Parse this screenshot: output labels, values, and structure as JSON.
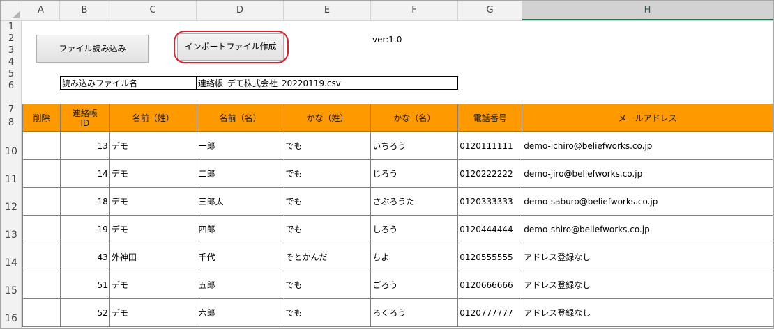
{
  "columns": [
    "A",
    "B",
    "C",
    "D",
    "E",
    "F",
    "G",
    "H"
  ],
  "active_column": "H",
  "rows": [
    "1",
    "2",
    "3",
    "4",
    "5",
    "6",
    "7",
    "8",
    "10",
    "11",
    "12",
    "13",
    "14",
    "15",
    "16"
  ],
  "buttons": {
    "load_file": "ファイル読み込み",
    "create_import": "インポートファイル作成"
  },
  "version": "ver:1.0",
  "file": {
    "label": "読み込みファイル名",
    "value": "連絡帳_デモ株式会社_20220119.csv"
  },
  "table": {
    "headers": [
      "削除",
      "連絡帳ID",
      "名前（姓）",
      "名前（名）",
      "かな（姓）",
      "かな（名）",
      "電話番号",
      "メールアドレス"
    ],
    "header_id_line1": "連絡帳",
    "header_id_line2": "ID",
    "rows": [
      {
        "delete": "",
        "id": "13",
        "last": "デモ",
        "first": "一郎",
        "kana_last": "でも",
        "kana_first": "いちろう",
        "phone": "0120111111",
        "email": "demo-ichiro@beliefworks.co.jp"
      },
      {
        "delete": "",
        "id": "14",
        "last": "デモ",
        "first": "二郎",
        "kana_last": "でも",
        "kana_first": "じろう",
        "phone": "0120222222",
        "email": "demo-jiro@beliefworks.co.jp"
      },
      {
        "delete": "",
        "id": "18",
        "last": "デモ",
        "first": "三郎太",
        "kana_last": "でも",
        "kana_first": "さぶろうた",
        "phone": "0120333333",
        "email": "demo-saburo@beliefworks.co.jp"
      },
      {
        "delete": "",
        "id": "19",
        "last": "デモ",
        "first": "四郎",
        "kana_last": "でも",
        "kana_first": "しろう",
        "phone": "0120444444",
        "email": "demo-shiro@beliefworks.co.jp"
      },
      {
        "delete": "",
        "id": "43",
        "last": "外神田",
        "first": "千代",
        "kana_last": "そとかんだ",
        "kana_first": "ちよ",
        "phone": "0120555555",
        "email": "アドレス登録なし"
      },
      {
        "delete": "",
        "id": "51",
        "last": "デモ",
        "first": "五郎",
        "kana_last": "でも",
        "kana_first": "ごろう",
        "phone": "0120666666",
        "email": "アドレス登録なし"
      },
      {
        "delete": "",
        "id": "52",
        "last": "デモ",
        "first": "六郎",
        "kana_last": "でも",
        "kana_first": "ろくろう",
        "phone": "0120777777",
        "email": "アドレス登録なし"
      }
    ]
  },
  "colors": {
    "header_fill": "#ff9900",
    "highlight": "#e0202e",
    "active_column_text": "#1d6d3e"
  }
}
